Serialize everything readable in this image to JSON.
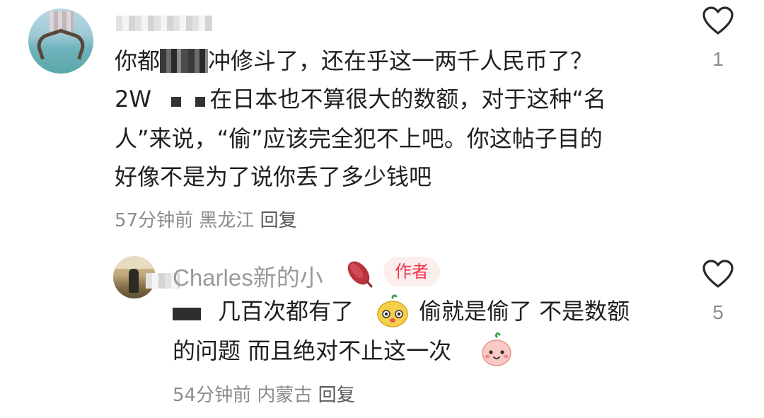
{
  "comment_1": {
    "line_1_a": "你都",
    "line_1_b": "冲修斗了，还在乎这一两千人民币了？",
    "line_2_a": "2W",
    "line_2_b": "在日本也不算很大的数额，对于这种“名",
    "line_3": "人”来说，“偷”应该完全犯不上吧。你这帖子目的",
    "line_4": "好像不是为了说你丢了多少钱吧",
    "time": "57分钟前",
    "location": "黑龙江",
    "reply_label": "回复",
    "likes": "1"
  },
  "reply_1": {
    "username": "Charles新的小",
    "author_badge": "作者",
    "line_1_a": "几百次都有了",
    "line_1_b": "偷就是偷了 不是数额",
    "line_2": "的问题 而且绝对不止这一次",
    "time": "54分钟前",
    "location": "内蒙古",
    "reply_label": "回复",
    "likes": "5"
  },
  "icons": {
    "like": "heart-outline-icon",
    "emoji_1": "yellow-face-emoji",
    "emoji_2": "pink-face-emoji",
    "username_emoji": "sweet-potato-emoji"
  },
  "colors": {
    "author_badge_bg": "#fdeeee",
    "author_badge_text": "#f0344a",
    "meta_text": "#8c8c8c",
    "body_text": "#1f1f1f"
  }
}
